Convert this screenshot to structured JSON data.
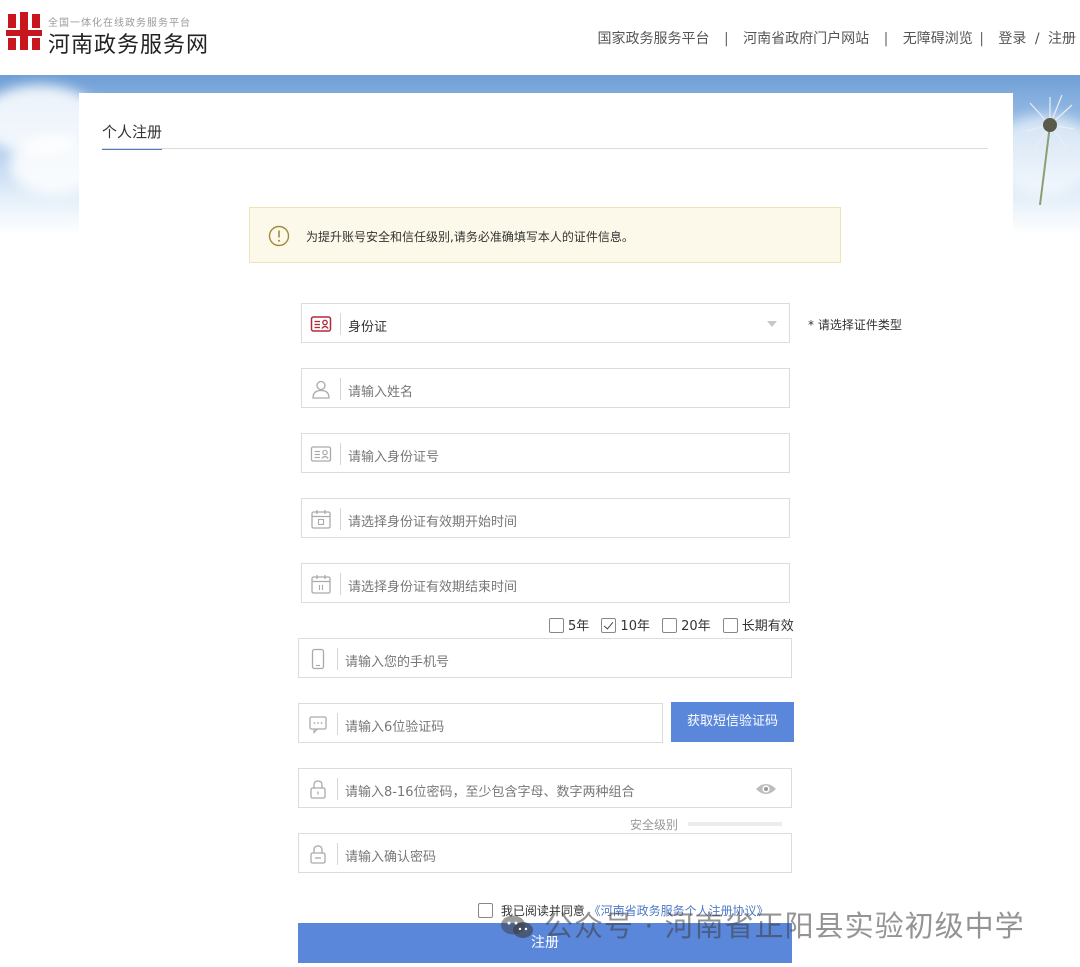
{
  "header": {
    "logo_subtitle": "全国一体化在线政务服务平台",
    "logo_title": "河南政务服务网",
    "nav": [
      {
        "label": "国家政务服务平台"
      },
      {
        "label": "河南省政府门户网站"
      },
      {
        "label": "无障碍浏览"
      }
    ],
    "login_label": "登录",
    "slash": "/",
    "register_label": "注册",
    "separator": "|"
  },
  "page": {
    "tab_title": "个人注册"
  },
  "notice": {
    "icon": "exclamation-circle-icon",
    "text": "为提升账号安全和信任级别,请务必准确填写本人的证件信息。"
  },
  "form": {
    "id_type": {
      "icon": "id-card-icon",
      "value": "身份证",
      "hint": "* 请选择证件类型"
    },
    "name": {
      "icon": "user-icon",
      "placeholder": "请输入姓名"
    },
    "id_number": {
      "icon": "id-card-icon",
      "placeholder": "请输入身份证号"
    },
    "valid_start": {
      "icon": "calendar-icon",
      "placeholder": "请选择身份证有效期开始时间"
    },
    "valid_end": {
      "icon": "calendar-icon",
      "placeholder": "请选择身份证有效期结束时间"
    },
    "validity_options": [
      {
        "label": "5年",
        "checked": false
      },
      {
        "label": "10年",
        "checked": true
      },
      {
        "label": "20年",
        "checked": false
      },
      {
        "label": "长期有效",
        "checked": false
      }
    ],
    "phone": {
      "icon": "phone-icon",
      "placeholder": "请输入您的手机号"
    },
    "sms_code": {
      "icon": "message-icon",
      "placeholder": "请输入6位验证码",
      "button": "获取短信验证码"
    },
    "password": {
      "icon": "lock-icon",
      "placeholder": "请输入8-16位密码，至少包含字母、数字两种组合",
      "eye_icon": "eye-icon"
    },
    "strength_label": "安全级别",
    "confirm_password": {
      "icon": "lock-icon",
      "placeholder": "请输入确认密码"
    },
    "agree_text": "我已阅读并同意",
    "agree_link": "《河南省政务服务个人注册协议》",
    "submit_label": "注册"
  },
  "watermark": {
    "text": "公众号 · 河南省正阳县实验初级中学"
  },
  "colors": {
    "accent": "#5b87db",
    "logo_red": "#c8161e",
    "notice_bg": "#fdf9ea"
  }
}
